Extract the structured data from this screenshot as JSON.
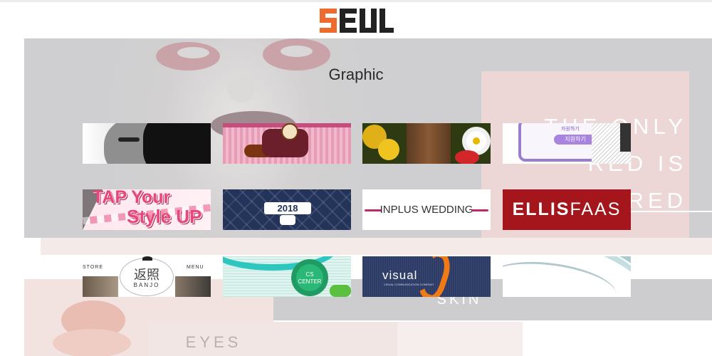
{
  "brand": {
    "logo_text": "SEUL",
    "accent": "#ef6b2d",
    "dark": "#2b2b2b"
  },
  "section": {
    "title": "Graphic"
  },
  "background": {
    "tagline": "THE ONLY\nRED IS\nREDRED",
    "skin_label": "SKIN",
    "eyes_label": "EYES"
  },
  "tiles": [
    {
      "name": "portrait-illustration"
    },
    {
      "name": "pink-character-clock"
    },
    {
      "name": "sunflowers-door"
    },
    {
      "name": "phone-apply",
      "label": "자원하기",
      "button": "지원하기"
    },
    {
      "name": "tap-your-style-up",
      "line1": "TAP Your",
      "line2": "Style UP"
    },
    {
      "name": "year-2018",
      "year": "2018"
    },
    {
      "name": "inplus-wedding",
      "text": "INPLUS WEDDING"
    },
    {
      "name": "ellis-faas",
      "part1": "ELLIS",
      "part2": "FAAS"
    },
    {
      "name": "banjo-store",
      "left": "STORE",
      "right": "MENU",
      "kanji": "返照",
      "brand": "BANJO"
    },
    {
      "name": "cs-center",
      "text": "CS\nCENTER"
    },
    {
      "name": "visual-communication",
      "title": "visual",
      "subtitle": "VISUAL COMMUNICATION COMPANY"
    },
    {
      "name": "teal-waves"
    }
  ]
}
